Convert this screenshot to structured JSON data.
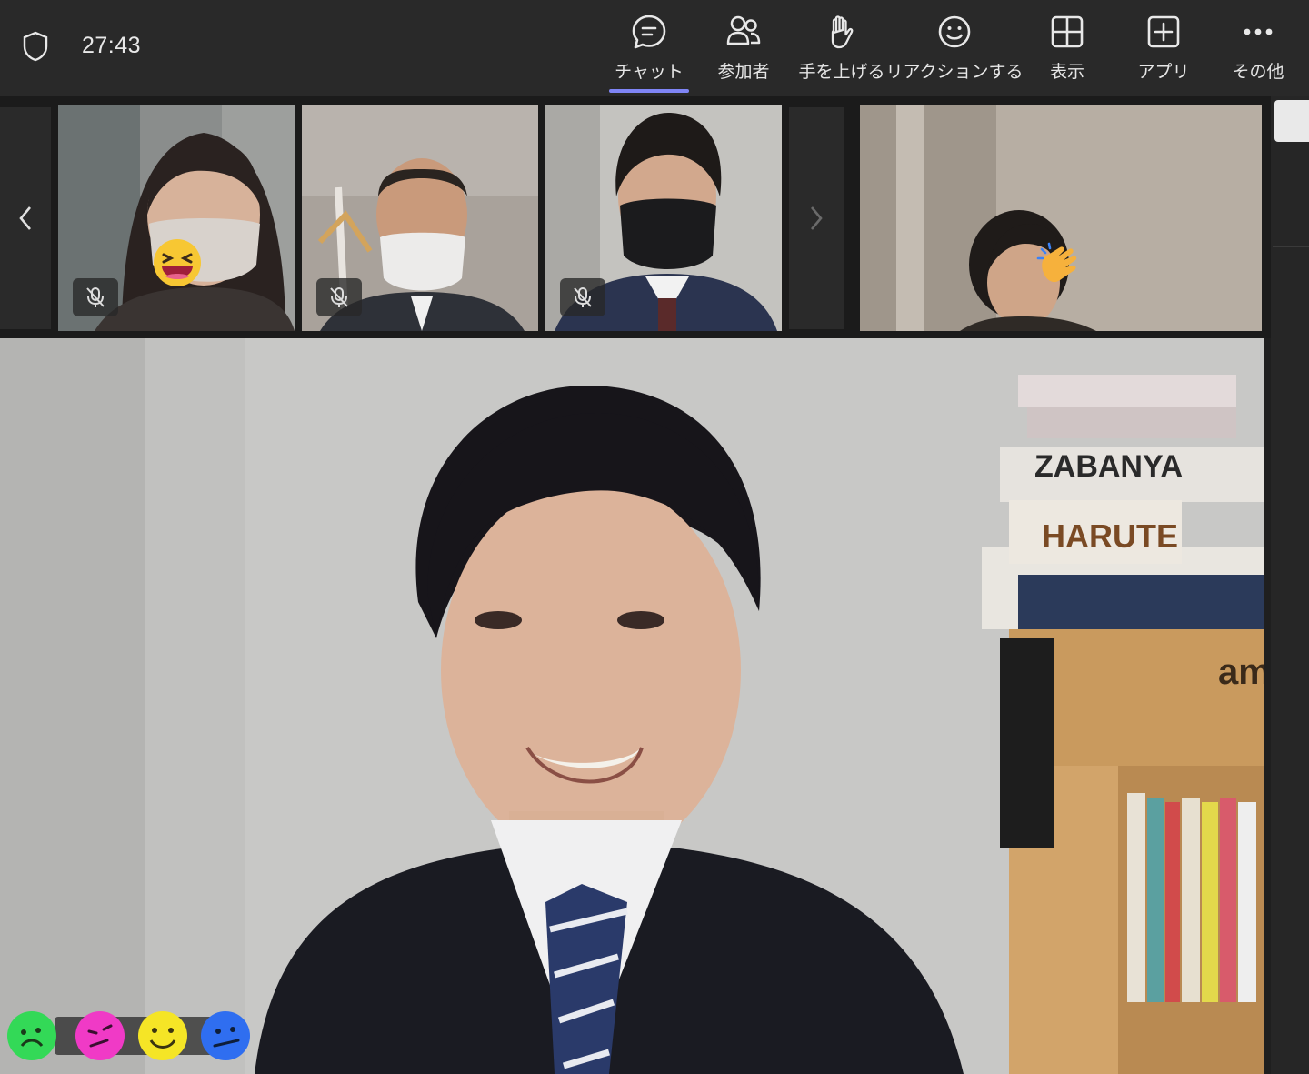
{
  "timer": "27:43",
  "toolbar": {
    "items": [
      {
        "label": "チャット",
        "icon": "chat-icon",
        "active": true
      },
      {
        "label": "参加者",
        "icon": "people-icon"
      },
      {
        "label": "手を上げる",
        "icon": "raise-hand-icon"
      },
      {
        "label": "リアクションする",
        "icon": "smiley-icon"
      },
      {
        "label": "表示",
        "icon": "grid-view-icon"
      },
      {
        "label": "アプリ",
        "icon": "add-app-icon"
      },
      {
        "label": "その他",
        "icon": "more-icon"
      }
    ],
    "accent": "#7f85f5"
  },
  "strip": {
    "tiles": [
      {
        "muted": true,
        "reaction": "laughing-emoji"
      },
      {
        "muted": true
      },
      {
        "muted": true
      },
      {
        "reaction": "clapping-emoji"
      }
    ]
  },
  "main_video": {
    "boxes": [
      "ZABANYA",
      "HARUTE"
    ],
    "box_brand": "am"
  },
  "reactions_bar": [
    "green-face-icon",
    "pink-face-icon",
    "yellow-smile-icon",
    "blue-face-icon"
  ]
}
